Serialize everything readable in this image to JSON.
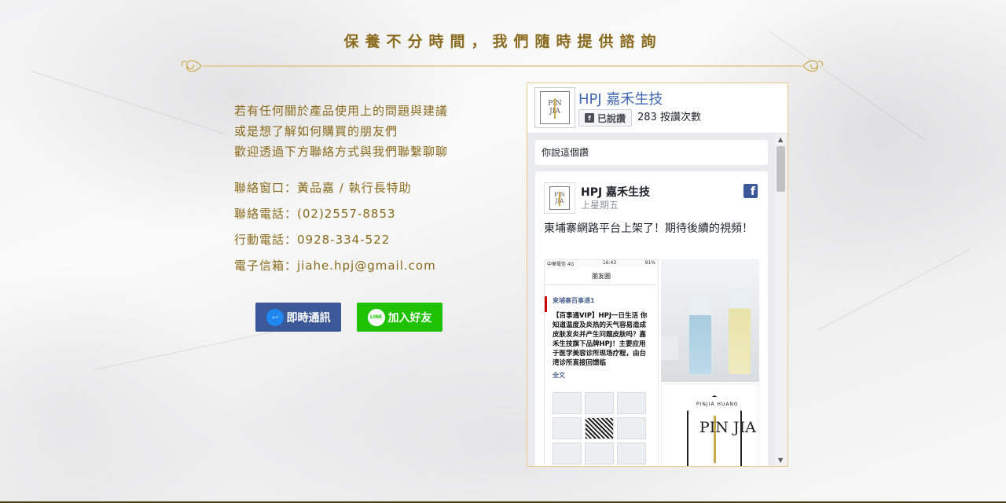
{
  "heading": "保養不分時間，我們隨時提供諮詢",
  "intro": {
    "line1": "若有任何關於產品使用上的問題與建議",
    "line2": "或是想了解如何購買的朋友們",
    "line3": "歡迎透過下方聯絡方式與我們聯繫聊聊"
  },
  "contacts": {
    "window": "聯絡窗口：黃品嘉 / 執行長特助",
    "phone": "聯絡電話：(02)2557-8853",
    "mobile": "行動電話：0928-334-522",
    "email": "電子信箱：jiahe.hpj@gmail.com"
  },
  "buttons": {
    "messenger": "即時通訊",
    "line": "加入好友",
    "line_icon_text": "LINE"
  },
  "facebook": {
    "page_name": "HPJ 嘉禾生技",
    "liked_label": "已說讚",
    "like_count": "283 按讚次數",
    "you_liked": "你說這個讚",
    "logo_text_top": "PIN",
    "logo_text_bottom": "JIA",
    "post": {
      "author": "HPJ 嘉禾生技",
      "time": "上星期五",
      "text": "東埔寨網路平台上架了！期待後續的視頻！",
      "screenshot": {
        "status_left": "中華電信 4G",
        "status_mid": "16:43",
        "status_right": "91%",
        "nav_title": "朋友圈",
        "account": "柬埔寨百事通1",
        "body": "【百事通VIP】HPJ一日生活 你知道温度及炎热的天气容易造成皮肤发炎并产生问题皮肤吗？嘉禾生技旗下品牌HPJ！主要应用于医学美容诊所现场疗程，由台湾诊所直接回馈临",
        "more": "全文"
      },
      "logo_small": "PINJIA HUANG",
      "logo_big": "PIN JIA"
    }
  },
  "colors": {
    "gold": "#8a6a1c",
    "messenger_blue": "#3b5998",
    "line_green": "#1ec200",
    "fb_blue": "#4267b2"
  }
}
